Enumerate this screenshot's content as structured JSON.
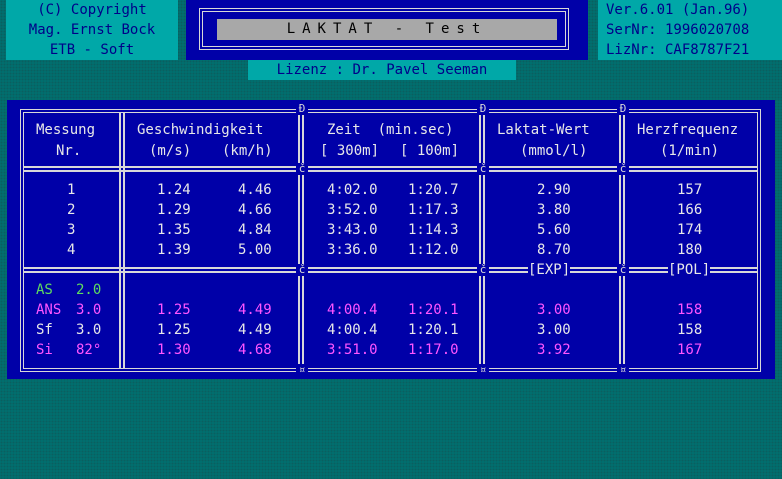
{
  "copyright": {
    "line1": "(C) Copyright",
    "line2": "Mag. Ernst Bock",
    "line3": "ETB - Soft"
  },
  "version": {
    "line1": "Ver.6.01 (Jan.96)",
    "line2": "SerNr: 1996020708",
    "line3": "LizNr: CAF8787F21"
  },
  "title": "LAKTAT - Test",
  "license": "Lizenz : Dr. Pavel Seeman",
  "header": {
    "messung_1": "Messung",
    "messung_2": "Nr.",
    "geschw_1": "Geschwindigkeit",
    "geschw_ms": "(m/s)",
    "geschw_kmh": "(km/h)",
    "zeit_1": "Zeit  (min.sec)",
    "zeit_300": "[ 300m]",
    "zeit_100": "[ 100m]",
    "laktat_1": "Laktat-Wert",
    "laktat_2": "(mmol/l)",
    "herz_1": "Herzfrequenz",
    "herz_2": "(1/min)"
  },
  "measurements": [
    {
      "nr": "1",
      "ms": "1.24",
      "kmh": "4.46",
      "t300": "4:02.0",
      "t100": "1:20.7",
      "laktat": "2.90",
      "hf": "157"
    },
    {
      "nr": "2",
      "ms": "1.29",
      "kmh": "4.66",
      "t300": "3:52.0",
      "t100": "1:17.3",
      "laktat": "3.80",
      "hf": "166"
    },
    {
      "nr": "3",
      "ms": "1.35",
      "kmh": "4.84",
      "t300": "3:43.0",
      "t100": "1:14.3",
      "laktat": "5.60",
      "hf": "174"
    },
    {
      "nr": "4",
      "ms": "1.39",
      "kmh": "5.00",
      "t300": "3:36.0",
      "t100": "1:12.0",
      "laktat": "8.70",
      "hf": "180"
    }
  ],
  "fit_labels": {
    "laktat": "[EXP]",
    "herz": "[POL]"
  },
  "thresholds": [
    {
      "label": "AS",
      "value": "2.0",
      "ms": "",
      "kmh": "",
      "t300": "",
      "t100": "",
      "laktat": "",
      "hf": ""
    },
    {
      "label": "ANS",
      "value": "3.0",
      "ms": "1.25",
      "kmh": "4.49",
      "t300": "4:00.4",
      "t100": "1:20.1",
      "laktat": "3.00",
      "hf": "158"
    },
    {
      "label": "Sf",
      "value": "3.0",
      "ms": "1.25",
      "kmh": "4.49",
      "t300": "4:00.4",
      "t100": "1:20.1",
      "laktat": "3.00",
      "hf": "158"
    },
    {
      "label": "Si",
      "value": "82°",
      "ms": "1.30",
      "kmh": "4.68",
      "t300": "3:51.0",
      "t100": "1:17.0",
      "laktat": "3.92",
      "hf": "167"
    }
  ],
  "colors": {
    "background": "#007070",
    "panel": "#0000a8",
    "box": "#00a8a8",
    "as": "#5fdc5f",
    "highlight": "#ff55ff",
    "text": "#e8e8e8"
  }
}
